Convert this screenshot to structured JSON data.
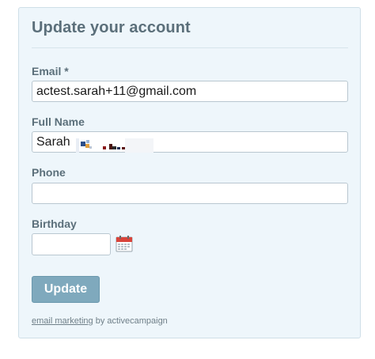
{
  "form": {
    "title": "Update your account",
    "email": {
      "label": "Email *",
      "value": "actest.sarah+11@gmail.com"
    },
    "full_name": {
      "label": "Full Name",
      "value": "Sarah"
    },
    "phone": {
      "label": "Phone",
      "value": ""
    },
    "birthday": {
      "label": "Birthday",
      "value": ""
    },
    "submit_label": "Update"
  },
  "footer": {
    "link_text": "email marketing",
    "suffix": " by activecampaign"
  },
  "icons": {
    "calendar": "calendar-icon"
  },
  "colors": {
    "panel_bg": "#eef6fb",
    "heading": "#5b6f7a",
    "button": "#7fa9bd"
  }
}
